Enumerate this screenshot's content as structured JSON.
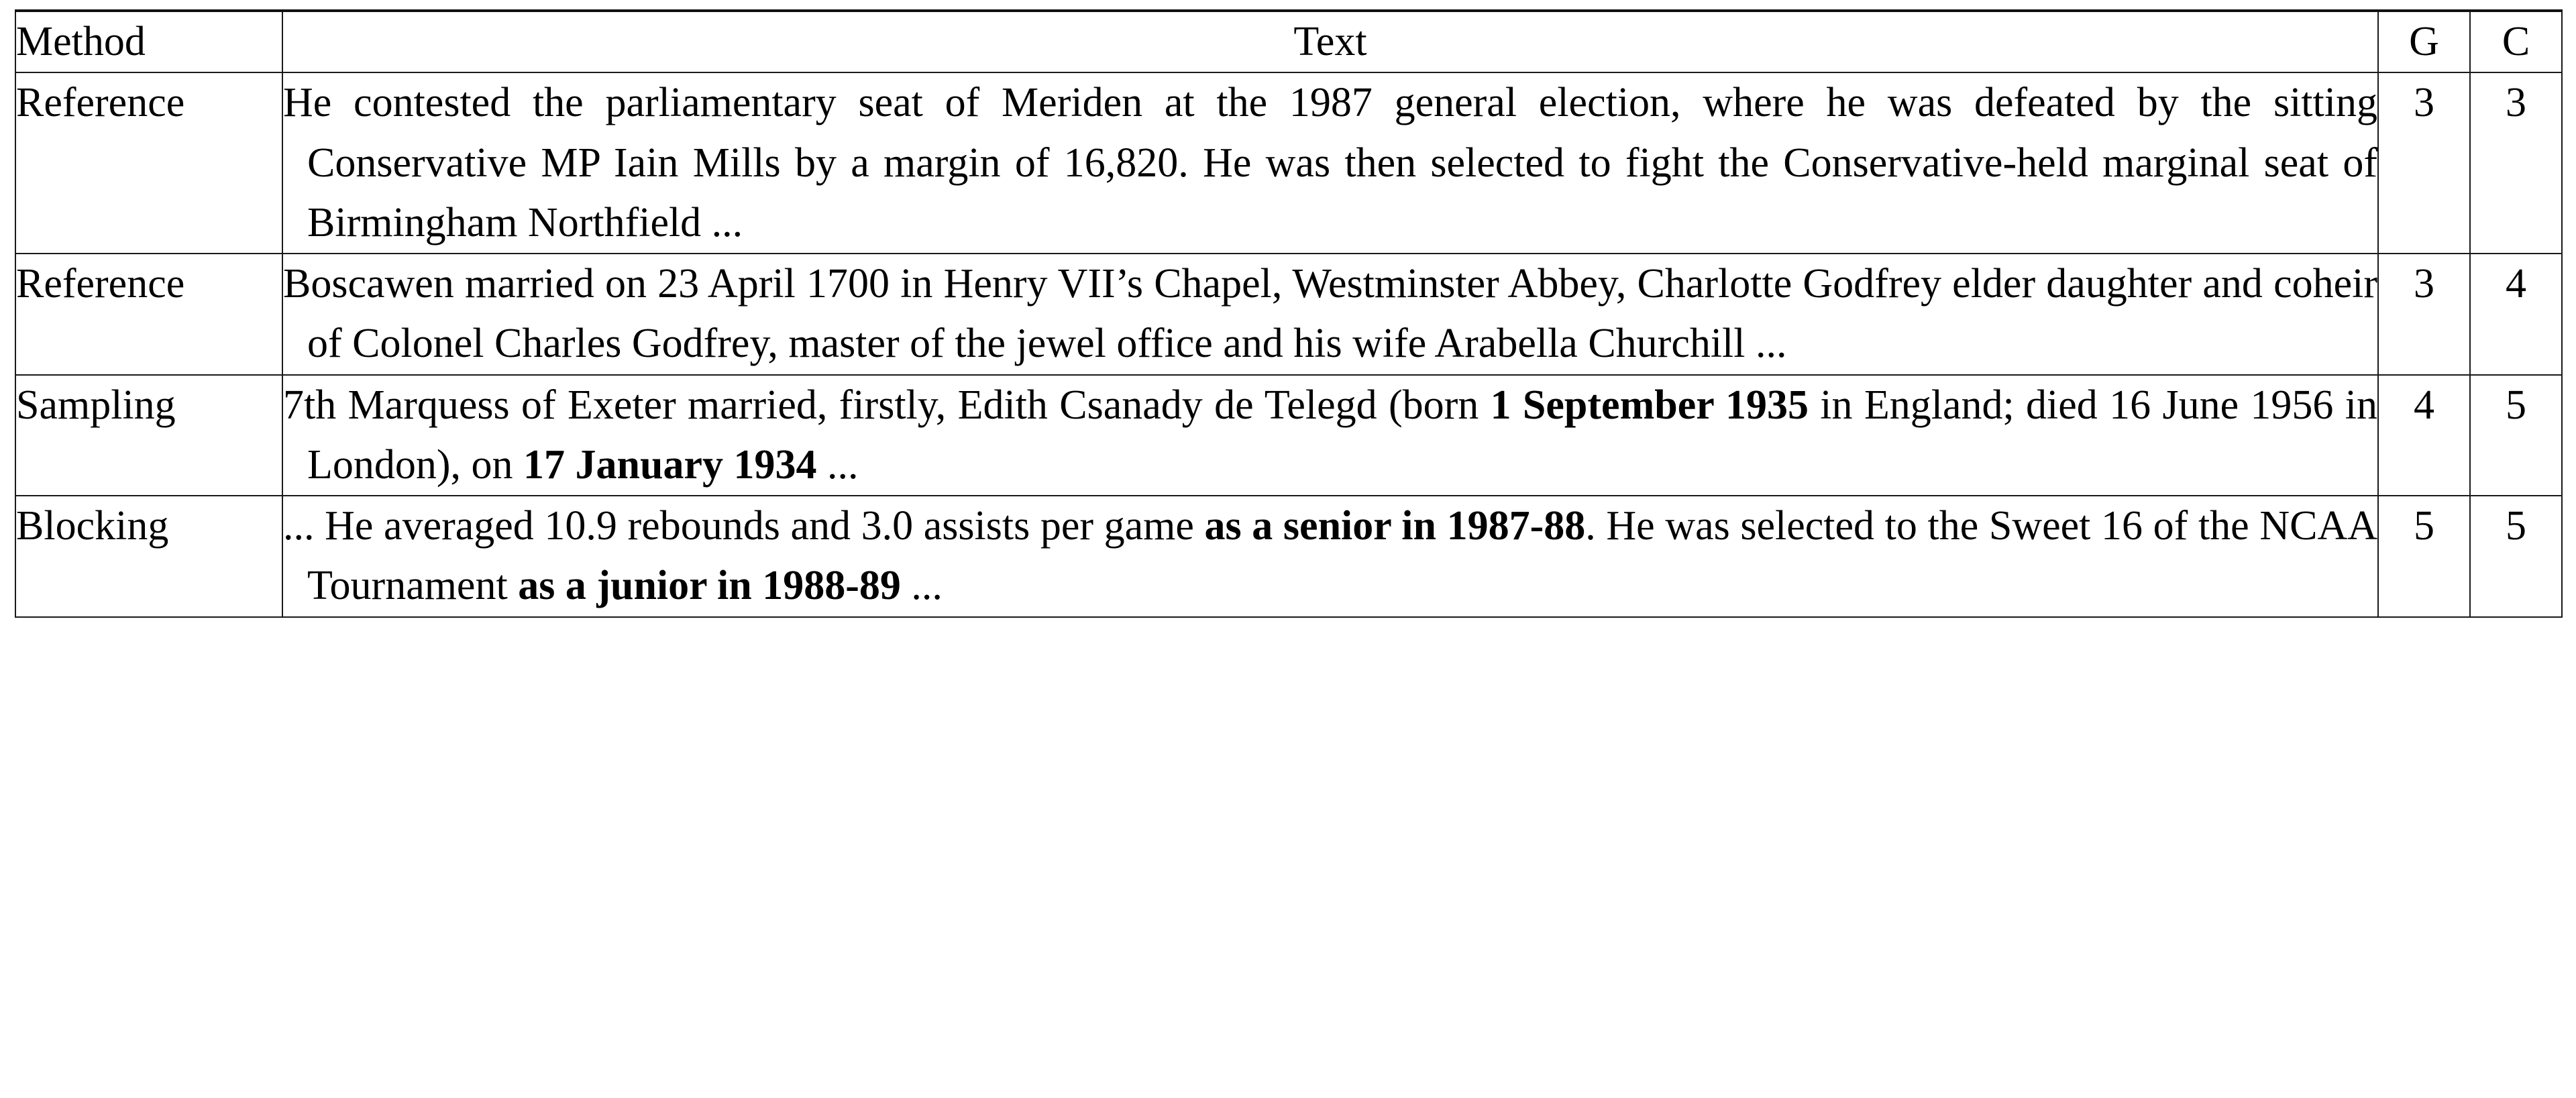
{
  "table": {
    "headers": {
      "method": "Method",
      "text": "Text",
      "g": "G",
      "c": "C"
    },
    "rows": [
      {
        "method": "Reference",
        "text_runs": [
          {
            "t": "He contested the parliamentary seat of Meriden at the 1987 general election, where he was defeated by the sitting Conservative MP Iain Mills by a margin of 16,820. He was then selected to fight the Conservative-held marginal seat of Birmingham Northfield ...",
            "bold": false
          }
        ],
        "text_plain": "He contested the parliamentary seat of Meriden at the 1987 general election, where he was defeated by the sitting Conservative MP Iain Mills by a margin of 16,820. He was then selected to fight the Conservative-held marginal seat of Birmingham Northfield ...",
        "g": "3",
        "c": "3"
      },
      {
        "method": "Reference",
        "text_runs": [
          {
            "t": "Boscawen married on 23 April 1700 in Henry VII’s Chapel, Westminster Abbey, Charlotte Godfrey elder daughter and coheir of Colonel Charles Godfrey, master of the jewel office and his wife Arabella Churchill ...",
            "bold": false
          }
        ],
        "text_plain": "Boscawen married on 23 April 1700 in Henry VII’s Chapel, Westminster Abbey, Charlotte Godfrey elder daughter and coheir of Colonel Charles Godfrey, master of the jewel office and his wife Arabella Churchill ...",
        "g": "3",
        "c": "4"
      },
      {
        "method": "Sampling",
        "text_runs": [
          {
            "t": "7th Marquess of Exeter married, firstly, Edith Csanady de Telegd (born ",
            "bold": false
          },
          {
            "t": "1 September 1935",
            "bold": true
          },
          {
            "t": " in England; died 16 June 1956 in London), on ",
            "bold": false
          },
          {
            "t": "17 January 1934",
            "bold": true
          },
          {
            "t": " ...",
            "bold": false
          }
        ],
        "text_plain": "7th Marquess of Exeter married, firstly, Edith Csanady de Telegd (born 1 September 1935 in England; died 16 June 1956 in London), on 17 January 1934 ...",
        "g": "4",
        "c": "5"
      },
      {
        "method": "Blocking",
        "text_runs": [
          {
            "t": "... He averaged 10.9 rebounds and 3.0 assists per game ",
            "bold": false
          },
          {
            "t": "as a senior in 1987-88",
            "bold": true
          },
          {
            "t": ". He was selected to the Sweet 16 of the NCAA Tournament ",
            "bold": false
          },
          {
            "t": "as a junior in 1988-89",
            "bold": true
          },
          {
            "t": " ...",
            "bold": false
          }
        ],
        "text_plain": "... He averaged 10.9 rebounds and 3.0 assists per game as a senior in 1987-88. He was selected to the Sweet 16 of the NCAA Tournament as a junior in 1988-89 ...",
        "g": "5",
        "c": "5"
      }
    ]
  },
  "style": {
    "rule_color": "#1a1a1a",
    "text_color": "#000000",
    "background": "#ffffff"
  }
}
